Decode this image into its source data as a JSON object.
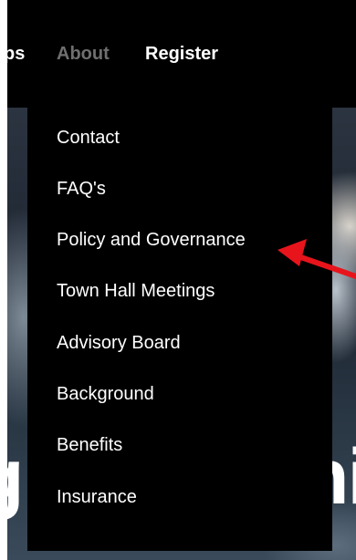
{
  "nav": {
    "partial_item": "ps",
    "about": "About",
    "register": "Register"
  },
  "hero": {
    "left_text": "g",
    "right_text": "ni"
  },
  "dropdown": {
    "items": [
      {
        "label": "Contact"
      },
      {
        "label": "FAQ's"
      },
      {
        "label": "Policy and Governance"
      },
      {
        "label": "Town Hall Meetings"
      },
      {
        "label": "Advisory Board"
      },
      {
        "label": "Background"
      },
      {
        "label": "Benefits"
      },
      {
        "label": "Insurance"
      }
    ]
  },
  "colors": {
    "background": "#000000",
    "menu_text": "#ffffff",
    "nav_inactive": "#6f6f6f",
    "annotation_arrow": "#e8141b"
  },
  "annotation": {
    "icon": "red-arrow-icon",
    "points_to": "Policy and Governance"
  }
}
